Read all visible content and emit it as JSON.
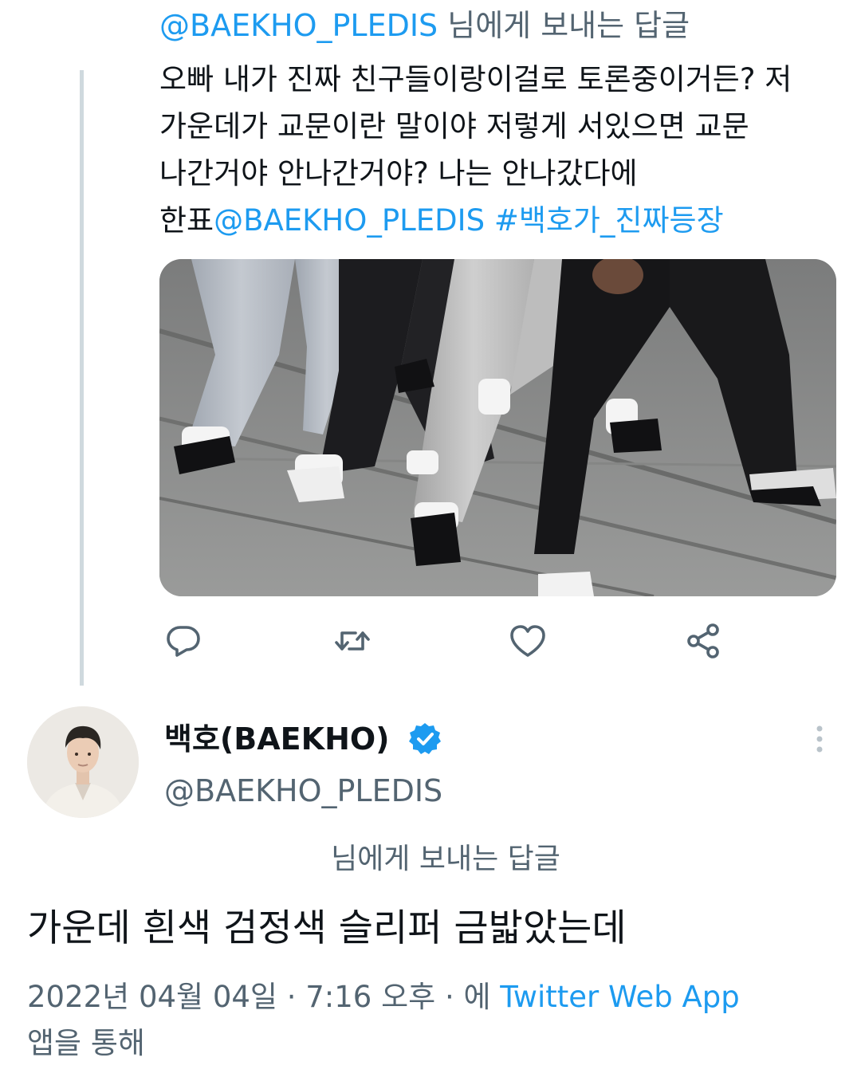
{
  "parent_tweet": {
    "reply_to_mention": "@BAEKHO_PLEDIS",
    "reply_to_suffix": " 님에게 보내는 답글",
    "text_lines": [
      "오빠 내가 진짜 친구들이랑이걸로 토론중이거든? 저",
      "가운데가 교문이란 말이야 저렇게 서있으면 교문",
      "나간거야 안나간거야? 나는 안나갔다에"
    ],
    "last_line_prefix": "한표",
    "last_line_mention": "@BAEKHO_PLEDIS",
    "last_line_hashtag": "#백호가_진짜등장",
    "action_icons": [
      "reply-icon",
      "retweet-icon",
      "like-icon",
      "share-icon"
    ]
  },
  "main_tweet": {
    "display_name": "백호(BAEKHO)",
    "handle": "@BAEKHO_PLEDIS",
    "verified": true,
    "reply_context": "님에게 보내는 답글",
    "text": "가운데 흰색 검정색 슬리퍼 금밟았는데",
    "timestamp_prefix": "2022년 04월 04일 · 7:16 오후 · 에 ",
    "source": "Twitter Web App",
    "source_suffix": "앱을 통해"
  },
  "colors": {
    "accent": "#1d9bf0",
    "secondary_text": "#536471",
    "primary_text": "#0f1419",
    "thread_line": "#cfd9de"
  }
}
